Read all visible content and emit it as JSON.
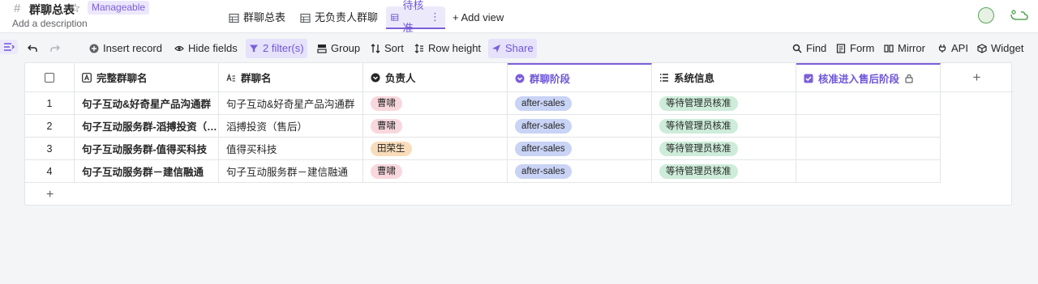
{
  "header": {
    "title": "群聊总表",
    "badge": "Manageable",
    "description": "Add a description",
    "tabs": [
      {
        "label": "群聊总表",
        "icon": "grid-icon"
      },
      {
        "label": "无负责人群聊",
        "icon": "grid-icon"
      },
      {
        "label": "待核准",
        "icon": "grid-icon",
        "active": true
      }
    ],
    "add_view": "+ Add view"
  },
  "toolbar": {
    "insert_record": "Insert record",
    "hide_fields": "Hide fields",
    "filter": "2 filter(s)",
    "group": "Group",
    "sort": "Sort",
    "row_height": "Row height",
    "share": "Share",
    "find": "Find",
    "form": "Form",
    "mirror": "Mirror",
    "api": "API",
    "widget": "Widget"
  },
  "table": {
    "columns": [
      {
        "label": "完整群聊名",
        "icon": "text-field-icon"
      },
      {
        "label": "群聊名",
        "icon": "formula-text-icon"
      },
      {
        "label": "负责人",
        "icon": "single-select-icon"
      },
      {
        "label": "群聊阶段",
        "icon": "single-select-icon"
      },
      {
        "label": "系统信息",
        "icon": "list-icon"
      },
      {
        "label": "核准进入售后阶段",
        "icon": "checkbox-icon"
      }
    ],
    "rows": [
      {
        "num": "1",
        "full_name": "句子互动&好奇星产品沟通群",
        "name": "句子互动&好奇星产品沟通群",
        "owner": "曹啸",
        "owner_color": "red",
        "stage": "after-sales",
        "info": "等待管理员核准"
      },
      {
        "num": "2",
        "full_name": "句子互动服务群-滔搏投资（…",
        "name": "滔搏投资（售后）",
        "owner": "曹啸",
        "owner_color": "red",
        "stage": "after-sales",
        "info": "等待管理员核准"
      },
      {
        "num": "3",
        "full_name": "句子互动服务群-值得买科技",
        "name": "值得买科技",
        "owner": "田荣生",
        "owner_color": "orange",
        "stage": "after-sales",
        "info": "等待管理员核准"
      },
      {
        "num": "4",
        "full_name": "句子互动服务群－建信融通",
        "name": "句子互动服务群－建信融通",
        "owner": "曹啸",
        "owner_color": "red",
        "stage": "after-sales",
        "info": "等待管理员核准"
      }
    ],
    "add_row": "+",
    "add_column": "+"
  }
}
